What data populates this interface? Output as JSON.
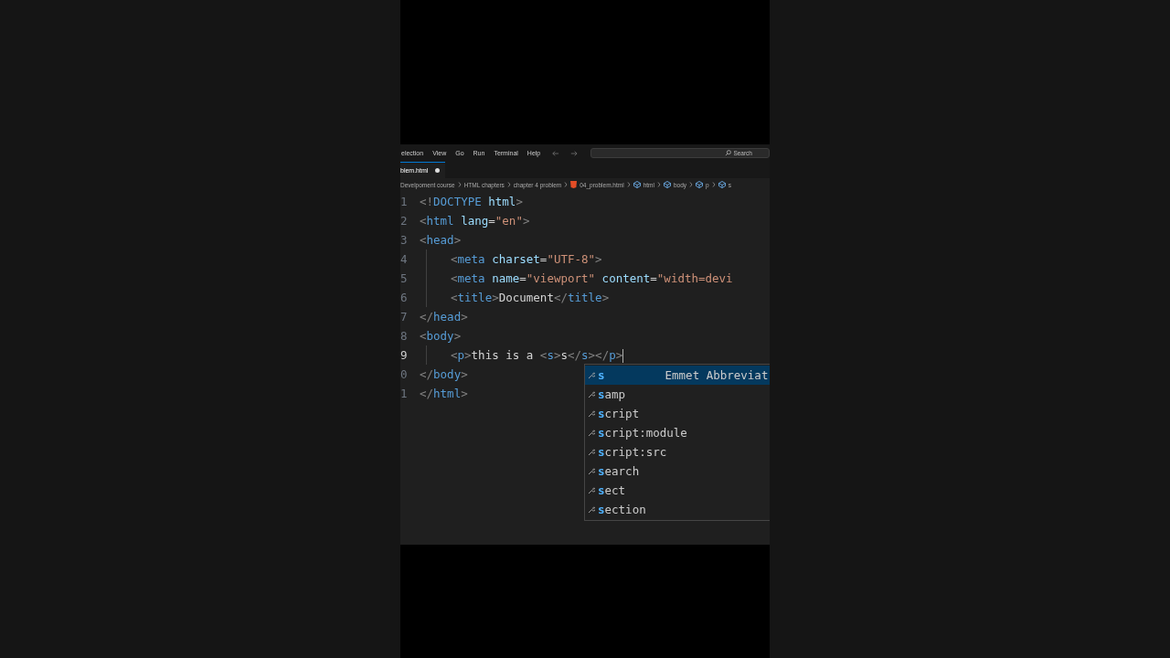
{
  "menu": [
    "election",
    "View",
    "Go",
    "Run",
    "Terminal",
    "Help"
  ],
  "search": {
    "placeholder": "Search"
  },
  "tab": {
    "label": "blem.html",
    "modified": true
  },
  "breadcrumbs": [
    {
      "label": "Develpoment course",
      "kind": "folder"
    },
    {
      "label": "HTML chapters",
      "kind": "folder"
    },
    {
      "label": "chapter 4 problem",
      "kind": "folder"
    },
    {
      "label": "04_problem.html",
      "kind": "file"
    },
    {
      "label": "html",
      "kind": "symbol"
    },
    {
      "label": "body",
      "kind": "symbol"
    },
    {
      "label": "p",
      "kind": "symbol"
    },
    {
      "label": "s",
      "kind": "symbol"
    }
  ],
  "lines": [
    {
      "number": "1",
      "current": false,
      "indent": false,
      "tokens": [
        {
          "t": "<!",
          "kind": "punct"
        },
        {
          "t": "DOCTYPE",
          "kind": "tag"
        },
        {
          "t": " html",
          "kind": "attr"
        },
        {
          "t": ">",
          "kind": "punct"
        }
      ]
    },
    {
      "number": "2",
      "current": false,
      "indent": false,
      "tokens": [
        {
          "t": "<",
          "kind": "punct"
        },
        {
          "t": "html",
          "kind": "tag"
        },
        {
          "t": " lang",
          "kind": "attr"
        },
        {
          "t": "=",
          "kind": "text"
        },
        {
          "t": "\"en\"",
          "kind": "string"
        },
        {
          "t": ">",
          "kind": "punct"
        }
      ]
    },
    {
      "number": "3",
      "current": false,
      "indent": false,
      "tokens": [
        {
          "t": "<",
          "kind": "punct"
        },
        {
          "t": "head",
          "kind": "tag"
        },
        {
          "t": ">",
          "kind": "punct"
        }
      ]
    },
    {
      "number": "4",
      "current": false,
      "indent": true,
      "tokens": [
        {
          "t": "<",
          "kind": "punct"
        },
        {
          "t": "meta",
          "kind": "tag"
        },
        {
          "t": " charset",
          "kind": "attr"
        },
        {
          "t": "=",
          "kind": "text"
        },
        {
          "t": "\"UTF-8\"",
          "kind": "string"
        },
        {
          "t": ">",
          "kind": "punct"
        }
      ]
    },
    {
      "number": "5",
      "current": false,
      "indent": true,
      "tokens": [
        {
          "t": "<",
          "kind": "punct"
        },
        {
          "t": "meta",
          "kind": "tag"
        },
        {
          "t": " name",
          "kind": "attr"
        },
        {
          "t": "=",
          "kind": "text"
        },
        {
          "t": "\"viewport\"",
          "kind": "string"
        },
        {
          "t": " content",
          "kind": "attr"
        },
        {
          "t": "=",
          "kind": "text"
        },
        {
          "t": "\"width=devi",
          "kind": "string"
        }
      ]
    },
    {
      "number": "6",
      "current": false,
      "indent": true,
      "tokens": [
        {
          "t": "<",
          "kind": "punct"
        },
        {
          "t": "title",
          "kind": "tag"
        },
        {
          "t": ">",
          "kind": "punct"
        },
        {
          "t": "Document",
          "kind": "text"
        },
        {
          "t": "</",
          "kind": "punct"
        },
        {
          "t": "title",
          "kind": "tag"
        },
        {
          "t": ">",
          "kind": "punct"
        }
      ]
    },
    {
      "number": "7",
      "current": false,
      "indent": false,
      "tokens": [
        {
          "t": "</",
          "kind": "punct"
        },
        {
          "t": "head",
          "kind": "tag"
        },
        {
          "t": ">",
          "kind": "punct"
        }
      ]
    },
    {
      "number": "8",
      "current": false,
      "indent": false,
      "tokens": [
        {
          "t": "<",
          "kind": "punct"
        },
        {
          "t": "body",
          "kind": "tag"
        },
        {
          "t": ">",
          "kind": "punct"
        }
      ]
    },
    {
      "number": "9",
      "current": true,
      "indent": true,
      "tokens": [
        {
          "t": "<",
          "kind": "punct"
        },
        {
          "t": "p",
          "kind": "tag"
        },
        {
          "t": ">",
          "kind": "punct"
        },
        {
          "t": "this is a ",
          "kind": "text"
        },
        {
          "t": "<",
          "kind": "punct"
        },
        {
          "t": "s",
          "kind": "tag"
        },
        {
          "t": ">",
          "kind": "punct"
        },
        {
          "t": "s",
          "kind": "text"
        },
        {
          "t": "</",
          "kind": "punct"
        },
        {
          "t": "s",
          "kind": "tag"
        },
        {
          "t": ">",
          "kind": "punct"
        },
        {
          "t": "</",
          "kind": "punct"
        },
        {
          "t": "p",
          "kind": "tag"
        },
        {
          "t": ">",
          "kind": "punct"
        }
      ]
    },
    {
      "number": "0",
      "current": false,
      "indent": false,
      "tokens": [
        {
          "t": "</",
          "kind": "punct"
        },
        {
          "t": "body",
          "kind": "tag"
        },
        {
          "t": ">",
          "kind": "punct"
        }
      ]
    },
    {
      "number": "1",
      "current": false,
      "indent": false,
      "tokens": [
        {
          "t": "</",
          "kind": "punct"
        },
        {
          "t": "html",
          "kind": "tag"
        },
        {
          "t": ">",
          "kind": "punct"
        }
      ]
    }
  ],
  "suggestions": [
    {
      "label": "**s**",
      "detail": "Emmet Abbreviat",
      "selected": true
    },
    {
      "label": "**s**amp",
      "selected": false
    },
    {
      "label": "**s**cript",
      "selected": false
    },
    {
      "label": "**s**cript:module",
      "selected": false
    },
    {
      "label": "**s**cript:src",
      "selected": false
    },
    {
      "label": "**s**earch",
      "selected": false
    },
    {
      "label": "**s**ect",
      "selected": false
    },
    {
      "label": "**s**ection",
      "selected": false
    }
  ]
}
